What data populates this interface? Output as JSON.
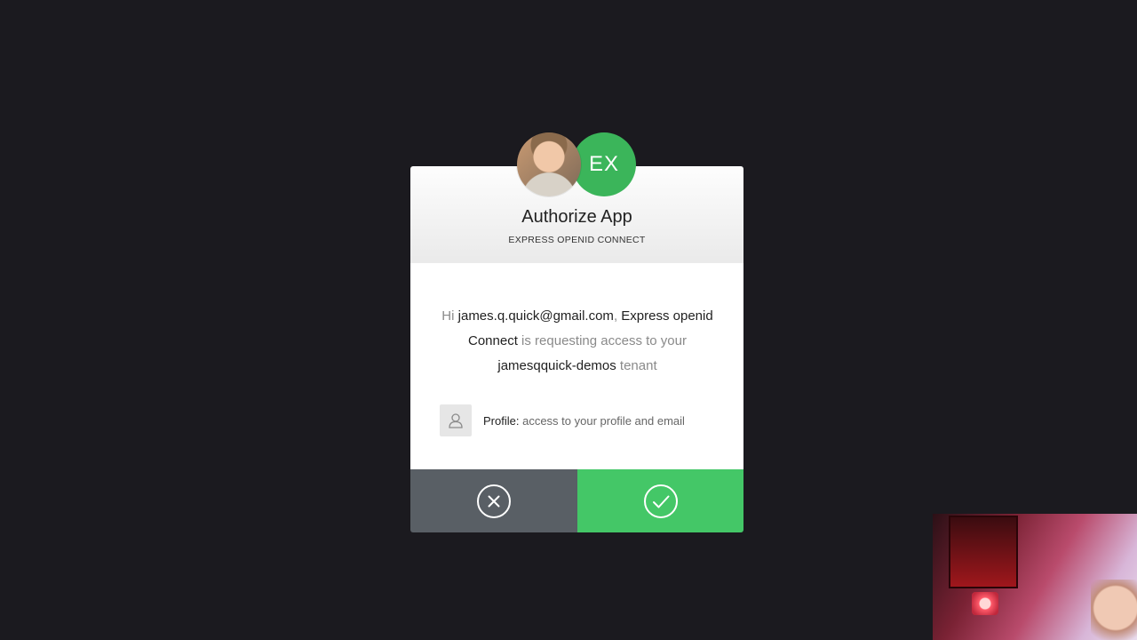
{
  "dialog": {
    "title": "Authorize App",
    "subtitle": "EXPRESS OPENID CONNECT",
    "app_avatar_initials": "EX",
    "message": {
      "greeting": "Hi",
      "email": "james.q.quick@gmail.com",
      "comma": ",",
      "app_name": "Express openid Connect",
      "requesting": "is requesting access to your",
      "tenant_name": "jamesqquick-demos",
      "tenant_word": "tenant"
    },
    "scope": {
      "label": "Profile:",
      "description": "access to your profile and email",
      "icon": "user-icon"
    },
    "actions": {
      "deny_icon": "close-circle-icon",
      "allow_icon": "check-circle-icon"
    },
    "colors": {
      "accent_green": "#44c767",
      "deny_gray": "#595f65",
      "app_avatar_green": "#3bb55a",
      "background": "#1b1a1f"
    }
  }
}
